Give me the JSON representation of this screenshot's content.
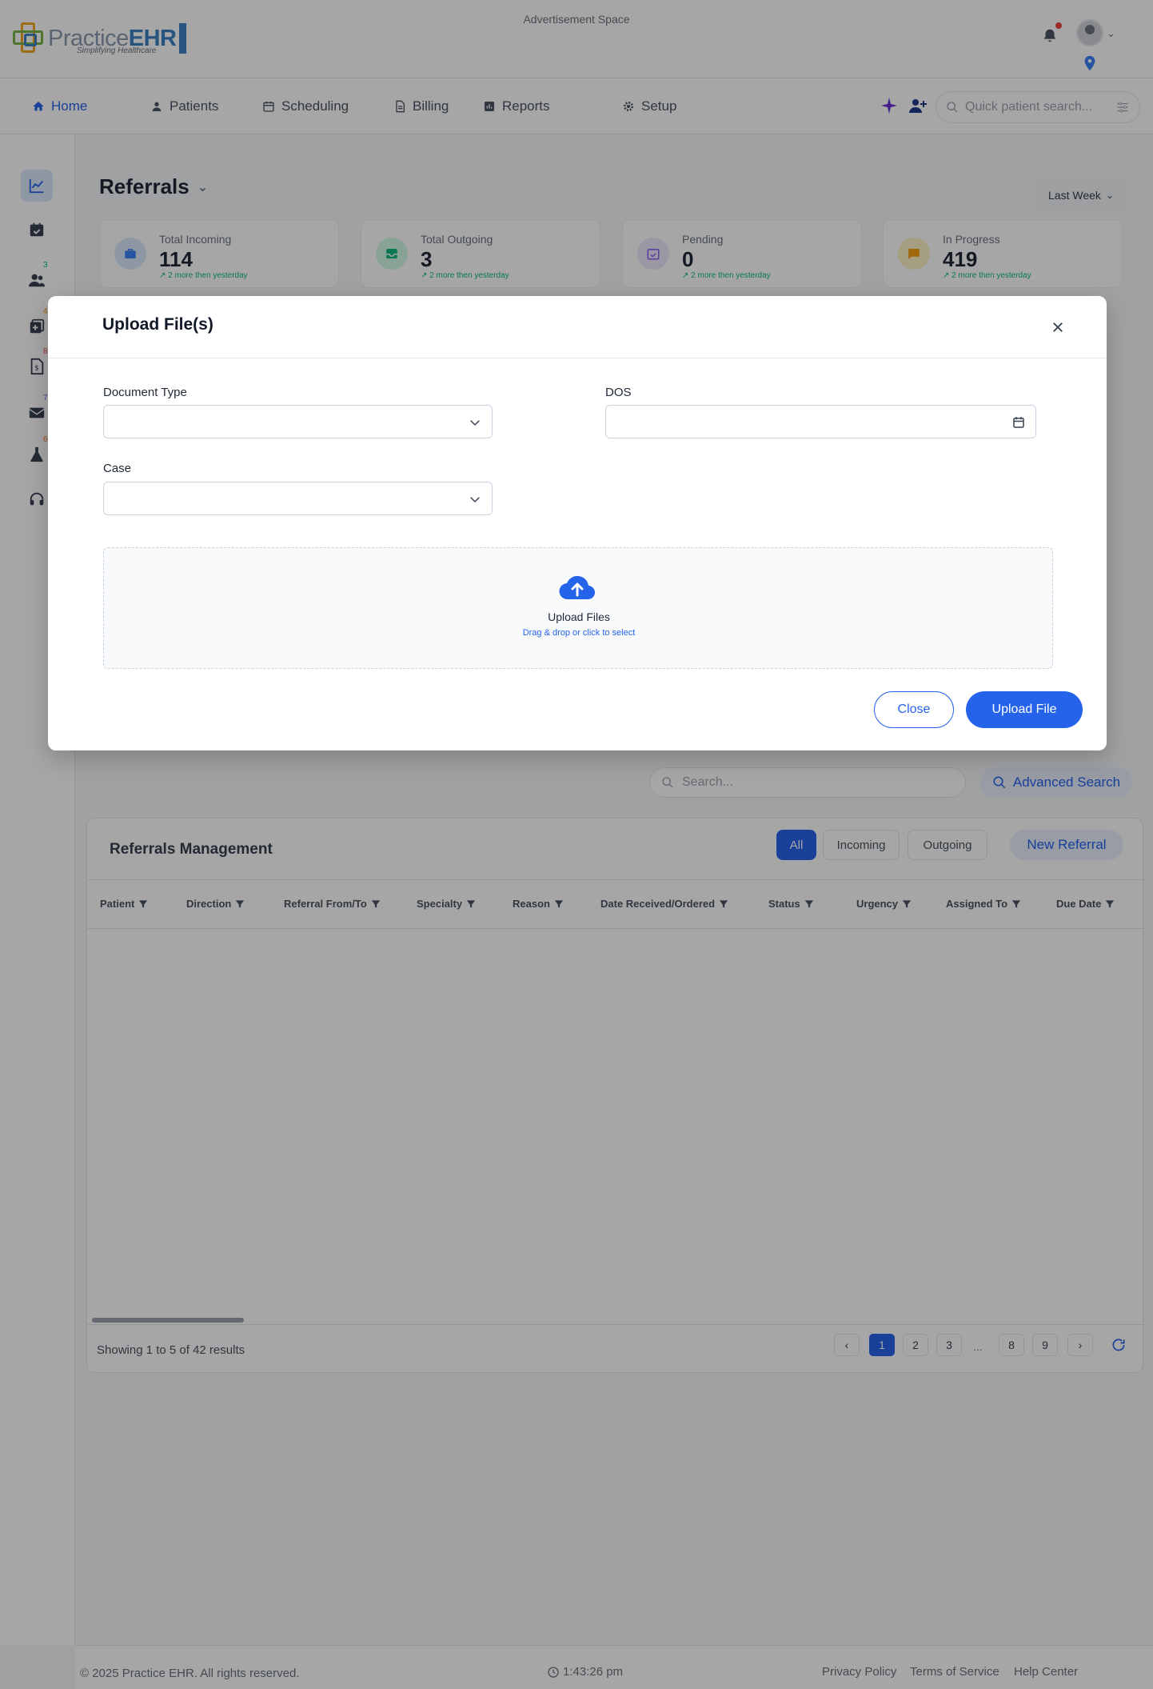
{
  "header": {
    "logo_text_a": "Practice",
    "logo_text_b": "EHR",
    "logo_tagline": "Simplifying Healthcare",
    "ad_space": "Advertisement Space"
  },
  "nav": {
    "items": [
      {
        "label": "Home",
        "icon": "home-icon"
      },
      {
        "label": "Patients",
        "icon": "patient-icon"
      },
      {
        "label": "Scheduling",
        "icon": "calendar-icon"
      },
      {
        "label": "Billing",
        "icon": "billing-icon"
      },
      {
        "label": "Reports",
        "icon": "reports-icon"
      },
      {
        "label": "Setup",
        "icon": "gear-icon"
      }
    ],
    "search_placeholder": "Quick patient search..."
  },
  "sidebar": {
    "badges": [
      "3",
      "4",
      "8",
      "7",
      "6"
    ]
  },
  "page": {
    "title": "Referrals",
    "range": "Last Week",
    "stats": [
      {
        "label": "Total Incoming",
        "value": "114",
        "trend": "2 more then yesterday",
        "color": "#3b82f6"
      },
      {
        "label": "Total Outgoing",
        "value": "3",
        "trend": "2 more then yesterday",
        "color": "#10b981"
      },
      {
        "label": "Pending",
        "value": "0",
        "trend": "2 more then yesterday",
        "color": "#8b5cf6"
      },
      {
        "label": "In Progress",
        "value": "419",
        "trend": "2 more then yesterday",
        "color": "#f59e0b"
      }
    ],
    "table_search_placeholder": "Search...",
    "advanced_search": "Advanced Search"
  },
  "referrals": {
    "title": "Referrals Management",
    "filters": [
      "All",
      "Incoming",
      "Outgoing"
    ],
    "new_referral": "New Referral",
    "columns": [
      "Patient",
      "Direction",
      "Referral From/To",
      "Specialty",
      "Reason",
      "Date Received/Ordered",
      "Status",
      "Urgency",
      "Assigned To",
      "Due Date"
    ],
    "showing": "Showing 1 to 5 of 42 results",
    "pages": [
      "1",
      "2",
      "3",
      "...",
      "8",
      "9"
    ]
  },
  "footer": {
    "copyright": "© 2025 Practice EHR. All rights reserved.",
    "time": "1:43:26 pm",
    "links": [
      "Privacy Policy",
      "Terms of Service",
      "Help Center"
    ]
  },
  "modal": {
    "title": "Upload File(s)",
    "document_type_label": "Document Type",
    "dos_label": "DOS",
    "case_label": "Case",
    "upload_title": "Upload Files",
    "upload_sub": "Drag & drop or click to select",
    "close_button": "Close",
    "upload_button": "Upload File"
  },
  "colors": {
    "primary": "#2563eb",
    "overlay": "rgba(0,0,0,0.35)"
  }
}
